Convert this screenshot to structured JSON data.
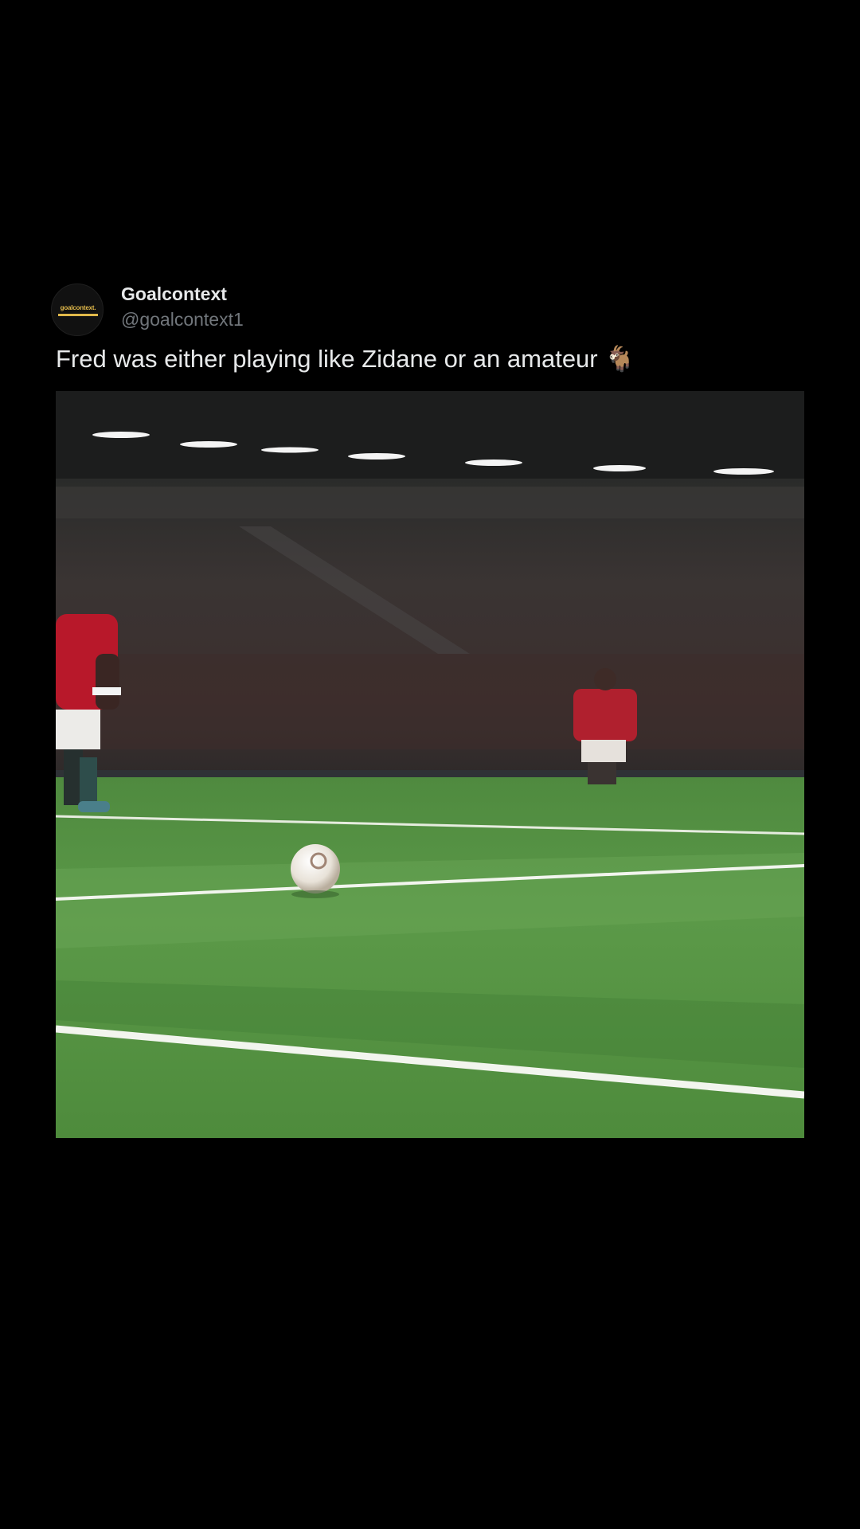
{
  "post": {
    "author": {
      "display_name": "Goalcontext",
      "handle": "@goalcontext1",
      "avatar_logo_text": "goalcontext.",
      "avatar_logo_color": "#e0b84a"
    },
    "text": "Fred was either playing like Zidane or an amateur 🐐",
    "emoji_icon": "goat-icon",
    "media": {
      "type": "video-frame"
    }
  },
  "colors": {
    "background": "#000000",
    "primary_text": "#e7e9ea",
    "secondary_text": "#71767b"
  }
}
